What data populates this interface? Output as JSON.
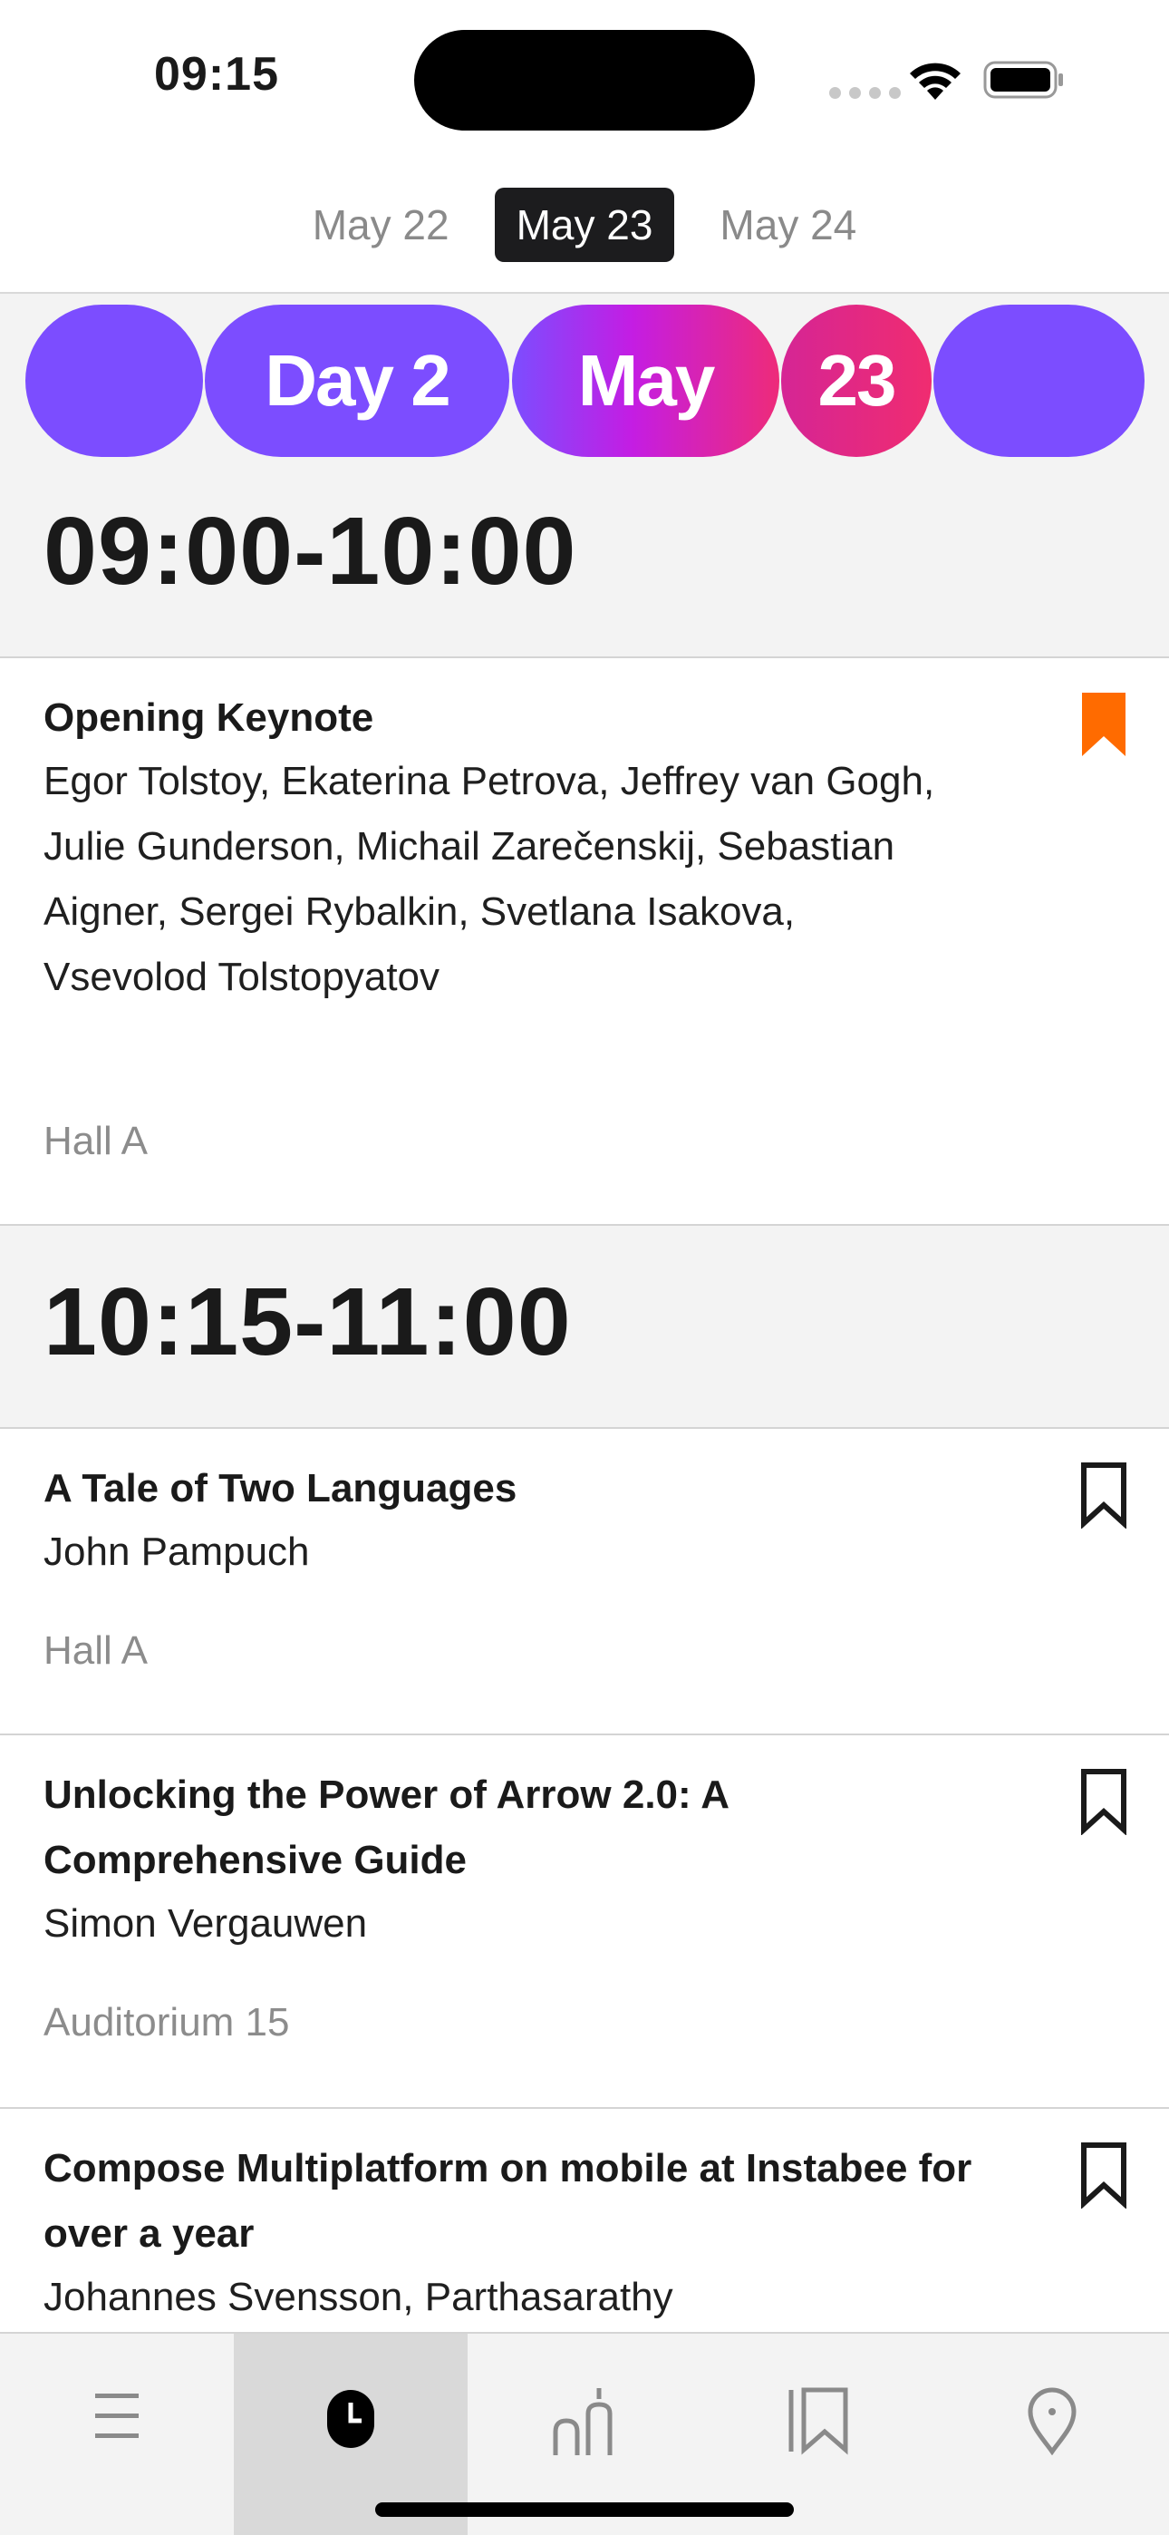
{
  "status_bar": {
    "time": "09:15"
  },
  "date_tabs": [
    {
      "label": "May 22",
      "active": false
    },
    {
      "label": "May 23",
      "active": true
    },
    {
      "label": "May 24",
      "active": false
    }
  ],
  "banner": {
    "day": "Day 2",
    "month": "May",
    "date": "23",
    "colors": {
      "purple": "#7c4dff",
      "magenta": "#c41de3",
      "pink": "#ee2b79"
    }
  },
  "slots": [
    {
      "time": "09:00-10:00",
      "sessions": [
        {
          "title": "Opening Keynote",
          "speakers": "Egor Tolstoy, Ekaterina Petrova, Jeffrey van Gogh, Julie Gunderson, Michail Zarečenskij, Sebastian Aigner, Sergei Rybalkin, Svetlana Isakova, Vsevolod Tolstopyatov",
          "room": "Hall A",
          "bookmarked": true
        }
      ]
    },
    {
      "time": "10:15-11:00",
      "sessions": [
        {
          "title": "A Tale of Two Languages",
          "speakers": "John Pampuch",
          "room": "Hall A",
          "bookmarked": false
        },
        {
          "title": "Unlocking the Power of Arrow 2.0: A Comprehensive Guide",
          "speakers": "Simon Vergauwen",
          "room": "Auditorium 15",
          "bookmarked": false
        },
        {
          "title": "Compose Multiplatform on mobile at Instabee for over a year",
          "speakers": "Johannes Svensson, Parthasarathy",
          "room": "",
          "bookmarked": false
        }
      ]
    }
  ],
  "bookmark_color": "#ff6b00",
  "nav": [
    {
      "icon": "menu-icon",
      "active": false
    },
    {
      "icon": "clock-icon",
      "active": true
    },
    {
      "icon": "speakers-icon",
      "active": false
    },
    {
      "icon": "bookmarks-icon",
      "active": false
    },
    {
      "icon": "location-pin-icon",
      "active": false
    }
  ]
}
